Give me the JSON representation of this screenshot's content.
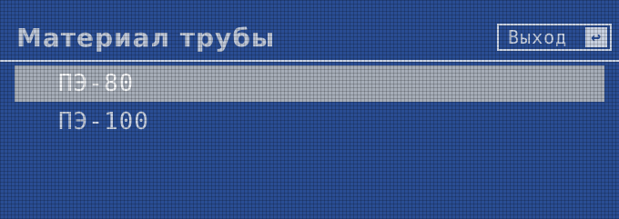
{
  "header": {
    "title": "Материал трубы",
    "exit_label": "Выход",
    "exit_icon": "↩"
  },
  "list": {
    "items": [
      {
        "label": "ПЭ-80",
        "selected": true
      },
      {
        "label": "ПЭ-100",
        "selected": false
      }
    ]
  },
  "colors": {
    "background": "#2a4d93",
    "text": "#c9d2e2",
    "selection": "#a6adb8"
  }
}
